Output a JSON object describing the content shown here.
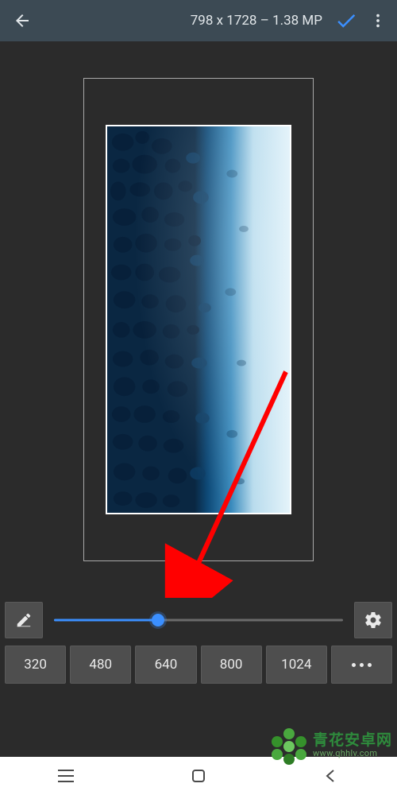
{
  "header": {
    "title": "798 x 1728 – 1.38 MP"
  },
  "slider": {
    "percent": 36
  },
  "presets": [
    "320",
    "480",
    "640",
    "800",
    "1024"
  ],
  "icons": {
    "back": "←",
    "confirm": "✓",
    "overflow": "⋮",
    "edit": "edit-icon",
    "settings": "gear-icon"
  },
  "annotation": {
    "arrow_color": "#ff0000"
  },
  "watermark": {
    "brand_cn": "青花安卓网",
    "url": "www.qhhlv.com",
    "petal_color": "#49a83e",
    "petal_dark": "#2e7d25"
  },
  "colors": {
    "accent": "#3b8fff",
    "topbar": "#3c4a54",
    "panel": "#4e4e4e",
    "bg": "#2b2b2b"
  }
}
